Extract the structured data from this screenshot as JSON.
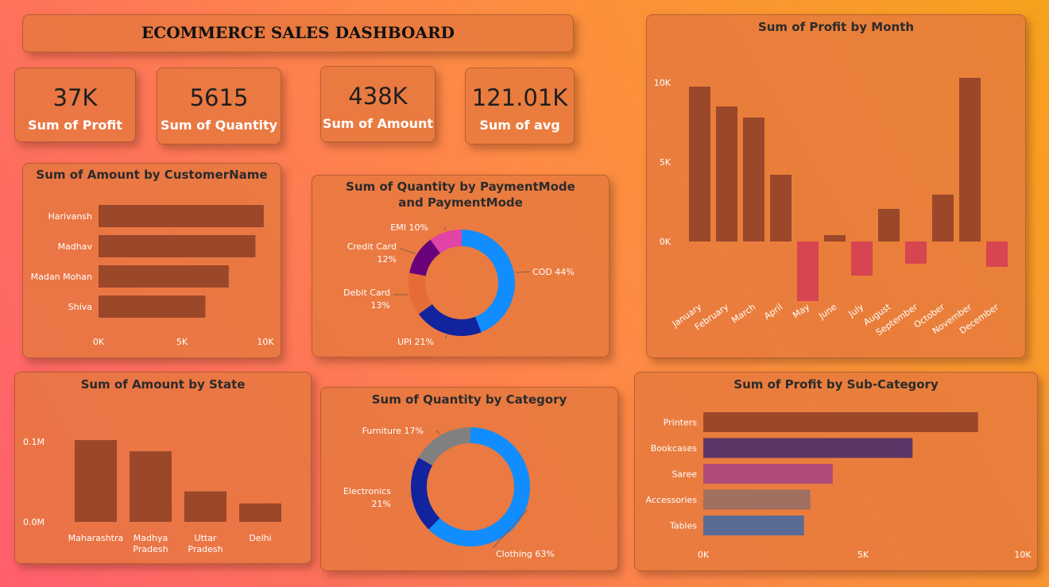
{
  "header": {
    "title": "ECOMMERCE SALES DASHBOARD"
  },
  "kpis": [
    {
      "value": "37K",
      "label": "Sum of Profit"
    },
    {
      "value": "5615",
      "label": "Sum of Quantity"
    },
    {
      "value": "438K",
      "label": "Sum of Amount"
    },
    {
      "value": "121.01K",
      "label": "Sum of avg"
    }
  ],
  "colors": {
    "bar": "#9b472a",
    "negative": "#d64550",
    "cod": "#118dff",
    "upi": "#12239e",
    "debit": "#e66c37",
    "credit": "#6b007b",
    "emi": "#e044a7",
    "furniture": "#808080",
    "subcat": [
      "#9b472a",
      "#5b3566",
      "#b04a78",
      "#a07060",
      "#5a6b95"
    ]
  },
  "chart_data": [
    {
      "id": "customer",
      "type": "bar",
      "orientation": "horizontal",
      "title": "Sum of Amount by CustomerName",
      "categories": [
        "Harivansh",
        "Madhav",
        "Madan Mohan",
        "Shiva"
      ],
      "values": [
        9900,
        9400,
        7800,
        6400
      ],
      "xlim": [
        0,
        10000
      ],
      "ticks": [
        "0K",
        "5K",
        "10K"
      ]
    },
    {
      "id": "payment",
      "type": "pie",
      "donut": true,
      "title": "Sum of Quantity by PaymentMode and PaymentMode",
      "slices": [
        {
          "label": "COD",
          "value": 44,
          "pct": "44%"
        },
        {
          "label": "UPI",
          "value": 21,
          "pct": "21%"
        },
        {
          "label": "Debit Card",
          "value": 13,
          "pct": "13%"
        },
        {
          "label": "Credit Card",
          "value": 12,
          "pct": "12%"
        },
        {
          "label": "EMI",
          "value": 10,
          "pct": "10%"
        }
      ]
    },
    {
      "id": "month",
      "type": "bar",
      "title": "Sum of Profit by Month",
      "categories": [
        "January",
        "February",
        "March",
        "April",
        "May",
        "June",
        "July",
        "August",
        "September",
        "October",
        "November",
        "December"
      ],
      "values": [
        9750,
        8500,
        7800,
        4200,
        -3750,
        400,
        -2150,
        2050,
        -1400,
        2950,
        10300,
        -1600
      ],
      "ylim": [
        -4500,
        11500
      ],
      "ticks": [
        {
          "v": 10000,
          "label": "10K"
        },
        {
          "v": 5000,
          "label": "5K"
        },
        {
          "v": 0,
          "label": "0K"
        }
      ]
    },
    {
      "id": "state",
      "type": "bar",
      "title": "Sum of Amount by State",
      "categories": [
        [
          "Maharashtra"
        ],
        [
          "Madhya",
          "Pradesh"
        ],
        [
          "Uttar",
          "Pradesh"
        ],
        [
          "Delhi"
        ]
      ],
      "values": [
        102000,
        88000,
        38000,
        23000
      ],
      "ylim": [
        0,
        110000
      ],
      "ticks": [
        {
          "v": 100000,
          "label": "0.1M"
        },
        {
          "v": 0,
          "label": "0.0M"
        }
      ]
    },
    {
      "id": "category",
      "type": "pie",
      "donut": true,
      "title": "Sum of Quantity by Category",
      "slices": [
        {
          "label": "Clothing",
          "value": 63,
          "pct": "63%"
        },
        {
          "label": "Electronics",
          "value": 21,
          "pct": "21%"
        },
        {
          "label": "Furniture",
          "value": 17,
          "pct": "17%"
        }
      ]
    },
    {
      "id": "subcat",
      "type": "bar",
      "orientation": "horizontal",
      "title": "Sum of Profit by Sub-Category",
      "categories": [
        "Printers",
        "Bookcases",
        "Saree",
        "Accessories",
        "Tables"
      ],
      "values": [
        8600,
        6550,
        4050,
        3350,
        3150
      ],
      "xlim": [
        0,
        10000
      ],
      "ticks": [
        "0K",
        "5K",
        "10K"
      ]
    }
  ]
}
